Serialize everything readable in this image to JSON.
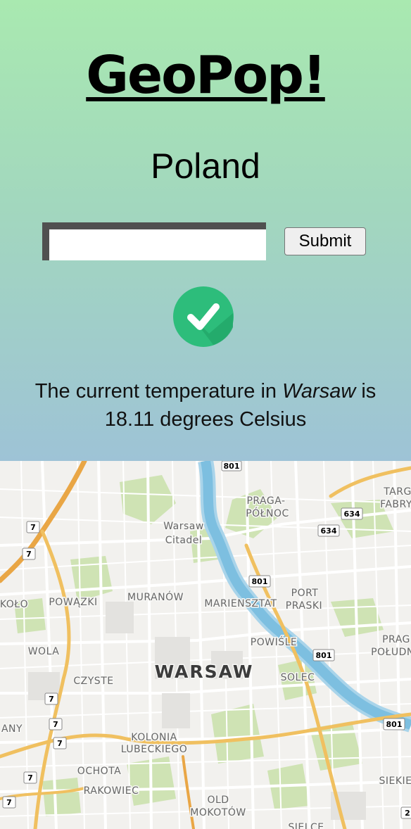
{
  "app": {
    "title": "GeoPop!"
  },
  "country": "Poland",
  "form": {
    "input_value": "",
    "submit_label": "Submit"
  },
  "status": {
    "icon": "check-icon",
    "color": "#2dbd7b"
  },
  "result": {
    "prefix": "The current temperature in ",
    "city": "Warsaw",
    "middle": " is",
    "value": "18.11 degrees Celsius"
  },
  "map": {
    "labels": {
      "warsaw": "WARSAW",
      "citadel_1": "Warsaw",
      "citadel_2": "Citadel",
      "praga_polnoc_1": "PRAGA-",
      "praga_polnoc_2": "PÓŁNOC",
      "targ_1": "TARG",
      "targ_2": "FABRY",
      "port_praski_1": "PORT",
      "port_praski_2": "PRASKI",
      "muranow": "MURANÓW",
      "powazki": "POWĄZKI",
      "kolo": "KOŁO",
      "mariensztat": "MARIENSZTAT",
      "powisle": "POWIŚLE",
      "prag_poludnie_1": "PRAG",
      "prag_poludnie_2": "POŁUDN",
      "wola": "WOLA",
      "czyste": "CZYSTE",
      "solec": "SOLEC",
      "any": "ANY",
      "kolonia_1": "KOLONIA",
      "kolonia_2": "LUBECKIEGO",
      "ochota": "OCHOTA",
      "rakowiec": "RAKOWIEC",
      "old_mokotow_1": "OLD",
      "old_mokotow_2": "MOKOTÓW",
      "siekierki": "SIEKIE",
      "sielce": "SIELCE"
    },
    "shields": {
      "r801_top": "801",
      "r634_a": "634",
      "r634_b": "634",
      "r801_mid": "801",
      "r801_river": "801",
      "r801_right": "801",
      "r7_a": "7",
      "r7_b": "7",
      "r7_c": "7",
      "r7_d": "7",
      "r7_e": "7",
      "r7_f": "7",
      "r7_g": "7",
      "r2": "2"
    }
  }
}
